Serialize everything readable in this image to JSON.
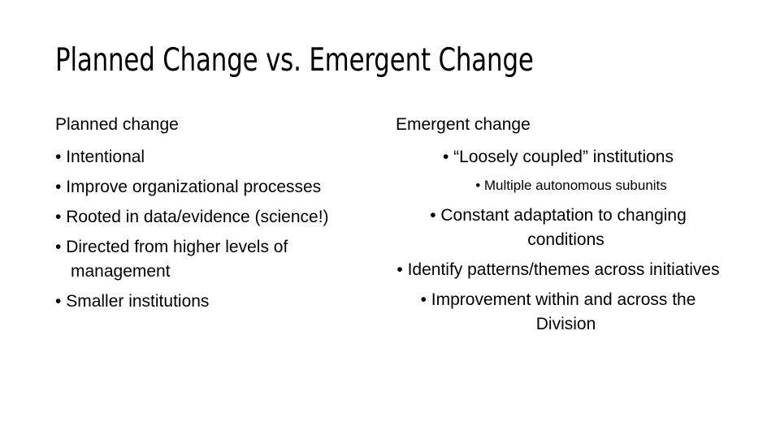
{
  "slide": {
    "title": "Planned Change vs. Emergent Change",
    "background_color": "#ffffff",
    "text_color": "#000000",
    "bullet_glyph": "•"
  },
  "left_column": {
    "heading": "Planned change",
    "bullets": [
      {
        "text": "Intentional"
      },
      {
        "text": "Improve organizational processes"
      },
      {
        "text": "Rooted in data/evidence (science!)"
      },
      {
        "text": "Directed from higher levels of management"
      },
      {
        "text": "Smaller institutions"
      }
    ]
  },
  "right_column": {
    "heading": "Emergent change",
    "bullets": [
      {
        "text": "“Loosely coupled” institutions"
      },
      {
        "text": "Constant adaptation to changing conditions"
      },
      {
        "text": "Identify patterns/themes across initiatives"
      },
      {
        "text": "Improvement within and across the Division"
      }
    ],
    "sub_bullets": [
      {
        "text": "Multiple autonomous subunits"
      }
    ]
  }
}
